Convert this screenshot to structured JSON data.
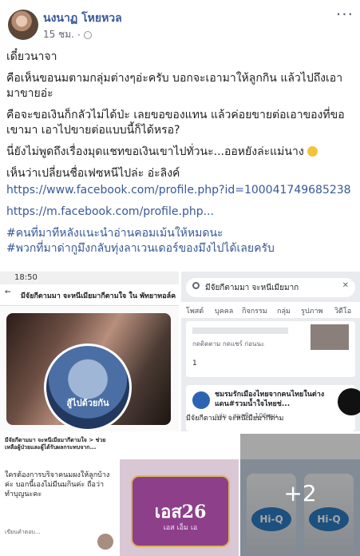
{
  "post": {
    "author": "นงนาฏ โหยหวล",
    "time": "15 ชม.",
    "more": "···",
    "paragraphs": [
      "เดี๋ยวนาจา",
      "คือเห็นขอนมตามกลุ่มต่างๆอ่ะครับ บอกจะเอามาให้ลูกกิน แล้วไปถึงเอามาขายอ่ะ",
      "คือจะขอเงินก็กลัวไม่ได้ป่ะ เลยขอของแทน แล้วค่อยขายต่อเอาของที่ขอเขามา เอาไปขายต่อแบบนี้ก็ได้หรอ?",
      "นี่ยังไม่พูดถึงเรื่องมุดแชทขอเงินเขาไปทั่วนะ...ออหยังล่ะแม่นาง",
      "เห็นว่าเปลี่ยนชื่อเฟซหนีไปล่ะ อ่ะลิงค์"
    ],
    "links": [
      "https://www.facebook.com/profile.php?id=100041749685238",
      "https://m.facebook.com/profile.php..."
    ],
    "hashtags": [
      "#คนที่มาทีหลังแนะนำอ่านคอมเม้นให้หมดนะ",
      "#พวกที่มาด่ากูมึงกลับทุ่งลาเวนเดอร์ของมึงไปได้เลยครับ"
    ]
  },
  "gallery": {
    "tile1": {
      "status_time": "18:50",
      "back": "←",
      "title": "มีจัยกีตามมา จะหนีเมียมากีตามใจ ใน พัทยาทอล์ค",
      "circle_label": "สู้ไปด้วยกัน"
    },
    "tile2": {
      "search_query": "มีจัยกีตามมา จะหนีเมียมาก",
      "close": "✕",
      "tabs": [
        "โพสต์",
        "บุคคล",
        "กิจกรรม",
        "กลุ่ม",
        "รูปภาพ",
        "วิดีโอ"
      ],
      "card1_sub": "กดติดตาม กดแชร์ ก่อนนะ",
      "card1_count": "1",
      "group_name": "ชมรมรักเมืองไทยจากคนไทยในต่างแดน#รวมน้ำใจไทยช่...",
      "group_meta": "กลุ่ม · สมาชิก 106 คน",
      "bottom_text": "มีจัยกีตามมา จะหนีเมียมากีตาม"
    },
    "tile3": {
      "header": "มีจัยกีตามมา จะหนีเมียมากีตามใจ > ช่วยเหลือผู้ป่วยและผู้ได้รับผลกระทบจาก...",
      "body": "ใครต้องการบริจาคนมผงให้ลูกบ้างค่ะ บอกนี้เองไม่มีนมกินค่ะ ถือว่าทำบุญนะคะ",
      "footer": "เขียนคำตอบ..."
    },
    "tile4": {
      "product_label": "เอส26",
      "product_sub": "เอส เอ็ม เอ"
    },
    "tile5": {
      "can_label": "Hi-Q",
      "more_count": "+2"
    }
  },
  "colors": {
    "link": "#385898",
    "author": "#385898",
    "text": "#1c1e21",
    "meta": "#616770"
  }
}
